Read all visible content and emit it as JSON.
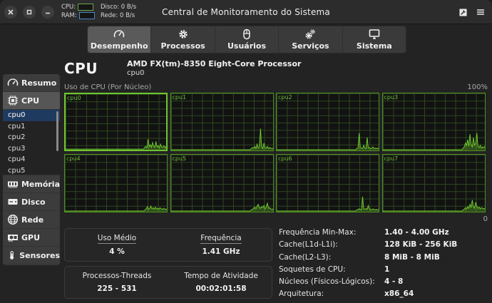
{
  "window": {
    "title": "Central de Monitoramento do Sistema",
    "mini": {
      "cpu_label": "CPU:",
      "ram_label": "RAM:",
      "disk_label": "Disco:",
      "disk_value": "0 B/s",
      "net_label": "Rede:",
      "net_value": "0 B/s"
    }
  },
  "tabs": [
    {
      "label": "Desempenho",
      "icon": "speedometer-icon",
      "active": true
    },
    {
      "label": "Processos",
      "icon": "gear-icon"
    },
    {
      "label": "Usuários",
      "icon": "mouse-icon"
    },
    {
      "label": "Serviços",
      "icon": "gears-icon"
    },
    {
      "label": "Sistema",
      "icon": "monitor-icon"
    }
  ],
  "sidebar": {
    "resumo": "Resumo",
    "cpu": "CPU",
    "cores": [
      "cpu0",
      "cpu1",
      "cpu2",
      "cpu3",
      "cpu4",
      "cpu5"
    ],
    "memoria": "Memória",
    "disco": "Disco",
    "rede": "Rede",
    "gpu": "GPU",
    "sensores": "Sensores"
  },
  "header": {
    "title": "CPU",
    "model": "AMD FX(tm)-8350 Eight-Core Processor",
    "selected": "cpu0"
  },
  "graph": {
    "label": "Uso de CPU (Por Núcleo)",
    "max": "100%",
    "min": "0",
    "line_color": "#6ec52f",
    "cores": [
      {
        "name": "cpu0",
        "values": [
          0,
          0,
          0,
          0,
          0,
          0,
          0,
          0,
          0,
          0,
          0,
          0,
          0,
          0,
          0,
          0,
          0,
          0,
          0,
          0,
          0,
          0,
          0,
          0,
          0,
          0,
          0,
          0,
          0,
          0,
          0,
          0,
          0,
          0,
          0,
          0,
          0,
          0,
          0,
          0,
          0,
          0,
          0,
          0,
          0,
          0,
          0,
          0,
          0,
          0,
          0,
          0,
          0,
          0,
          0,
          0,
          0,
          0,
          0,
          0,
          0,
          0,
          0,
          0,
          0,
          0,
          0,
          0,
          0,
          0,
          3,
          5,
          2,
          18,
          4,
          8,
          3,
          12,
          5,
          3,
          14,
          4,
          6,
          2,
          9,
          4,
          3,
          6,
          2,
          5
        ]
      },
      {
        "name": "cpu1",
        "values": [
          0,
          0,
          0,
          0,
          0,
          0,
          0,
          0,
          0,
          0,
          0,
          0,
          0,
          0,
          0,
          0,
          0,
          0,
          0,
          0,
          0,
          0,
          0,
          0,
          0,
          0,
          0,
          0,
          0,
          0,
          0,
          0,
          0,
          0,
          0,
          0,
          0,
          0,
          0,
          0,
          0,
          0,
          0,
          0,
          0,
          0,
          0,
          0,
          0,
          0,
          0,
          0,
          0,
          0,
          0,
          0,
          0,
          0,
          0,
          0,
          0,
          0,
          0,
          0,
          0,
          0,
          0,
          0,
          0,
          0,
          2,
          4,
          3,
          6,
          2,
          10,
          3,
          5,
          38,
          6,
          2,
          12,
          4,
          3,
          6,
          2,
          4,
          3,
          2,
          3
        ]
      },
      {
        "name": "cpu2",
        "values": [
          0,
          0,
          0,
          0,
          0,
          0,
          0,
          0,
          0,
          0,
          0,
          0,
          0,
          0,
          0,
          0,
          0,
          0,
          0,
          0,
          0,
          0,
          0,
          0,
          0,
          0,
          0,
          0,
          0,
          0,
          0,
          0,
          0,
          0,
          0,
          0,
          0,
          0,
          0,
          0,
          0,
          0,
          0,
          0,
          0,
          0,
          0,
          0,
          0,
          0,
          0,
          0,
          0,
          0,
          0,
          0,
          0,
          0,
          0,
          0,
          0,
          0,
          0,
          0,
          0,
          0,
          0,
          0,
          0,
          0,
          2,
          3,
          30,
          4,
          3,
          2,
          8,
          3,
          2,
          22,
          3,
          4,
          2,
          3,
          5,
          2,
          3,
          2,
          3,
          2
        ]
      },
      {
        "name": "cpu3",
        "values": [
          0,
          0,
          0,
          0,
          0,
          0,
          0,
          0,
          0,
          0,
          0,
          0,
          0,
          0,
          0,
          0,
          0,
          0,
          0,
          0,
          0,
          0,
          0,
          0,
          0,
          0,
          0,
          0,
          0,
          0,
          0,
          0,
          0,
          0,
          0,
          0,
          0,
          0,
          0,
          0,
          0,
          0,
          0,
          0,
          0,
          0,
          0,
          0,
          0,
          0,
          0,
          0,
          0,
          0,
          0,
          0,
          0,
          0,
          0,
          0,
          0,
          0,
          0,
          0,
          0,
          0,
          0,
          0,
          0,
          0,
          3,
          5,
          12,
          8,
          18,
          6,
          28,
          10,
          5,
          22,
          8,
          12,
          30,
          6,
          4,
          8,
          3,
          5,
          4,
          6
        ]
      },
      {
        "name": "cpu4",
        "values": [
          0,
          0,
          0,
          0,
          0,
          0,
          0,
          0,
          0,
          0,
          0,
          0,
          0,
          0,
          0,
          0,
          0,
          0,
          0,
          0,
          0,
          0,
          0,
          0,
          0,
          0,
          0,
          0,
          0,
          0,
          0,
          0,
          0,
          0,
          0,
          0,
          0,
          0,
          0,
          0,
          0,
          0,
          0,
          0,
          0,
          0,
          0,
          0,
          0,
          0,
          0,
          0,
          0,
          0,
          0,
          0,
          0,
          0,
          0,
          0,
          0,
          0,
          0,
          0,
          0,
          0,
          0,
          0,
          0,
          0,
          2,
          4,
          8,
          3,
          5,
          9,
          4,
          6,
          3,
          7,
          4,
          5,
          3,
          6,
          4,
          3,
          5,
          3,
          4,
          3
        ]
      },
      {
        "name": "cpu5",
        "values": [
          0,
          0,
          0,
          0,
          0,
          0,
          0,
          0,
          0,
          0,
          0,
          0,
          0,
          0,
          0,
          0,
          0,
          0,
          0,
          0,
          0,
          0,
          0,
          0,
          0,
          0,
          0,
          0,
          0,
          0,
          0,
          0,
          0,
          0,
          0,
          0,
          0,
          0,
          0,
          0,
          0,
          0,
          0,
          0,
          0,
          0,
          0,
          0,
          0,
          0,
          0,
          0,
          0,
          0,
          0,
          0,
          0,
          0,
          0,
          0,
          0,
          0,
          0,
          0,
          0,
          0,
          0,
          0,
          0,
          0,
          2,
          3,
          5,
          7,
          4,
          9,
          12,
          6,
          5,
          8,
          6,
          10,
          4,
          7,
          14,
          5,
          6,
          4,
          3,
          4
        ]
      },
      {
        "name": "cpu6",
        "values": [
          0,
          0,
          0,
          0,
          0,
          0,
          0,
          0,
          0,
          0,
          0,
          0,
          0,
          0,
          0,
          0,
          0,
          0,
          0,
          0,
          0,
          0,
          0,
          0,
          0,
          0,
          0,
          0,
          0,
          0,
          0,
          0,
          0,
          0,
          0,
          0,
          0,
          0,
          0,
          0,
          0,
          0,
          0,
          0,
          0,
          0,
          0,
          0,
          0,
          0,
          0,
          0,
          0,
          0,
          0,
          0,
          0,
          0,
          0,
          0,
          0,
          0,
          0,
          0,
          0,
          0,
          0,
          0,
          0,
          0,
          2,
          3,
          4,
          3,
          2,
          26,
          4,
          3,
          5,
          3,
          10,
          4,
          3,
          2,
          4,
          3,
          2,
          3,
          2,
          3
        ]
      },
      {
        "name": "cpu7",
        "values": [
          0,
          0,
          0,
          0,
          0,
          0,
          0,
          0,
          0,
          0,
          0,
          0,
          0,
          0,
          0,
          0,
          0,
          0,
          0,
          0,
          0,
          0,
          0,
          0,
          0,
          0,
          0,
          0,
          0,
          0,
          0,
          0,
          0,
          0,
          0,
          0,
          0,
          0,
          0,
          0,
          0,
          0,
          0,
          0,
          0,
          0,
          0,
          0,
          0,
          0,
          0,
          0,
          0,
          0,
          0,
          0,
          0,
          0,
          0,
          0,
          0,
          0,
          0,
          0,
          0,
          0,
          0,
          0,
          0,
          0,
          2,
          3,
          6,
          4,
          8,
          5,
          12,
          6,
          20,
          8,
          5,
          16,
          9,
          5,
          7,
          4,
          6,
          5,
          4,
          5
        ]
      }
    ]
  },
  "stats": {
    "uso_medio_label": "Uso Médio",
    "uso_medio_value": "4 %",
    "frequencia_label": "Frequência",
    "frequencia_value": "1.41 GHz",
    "processos_label": "Processos-Threads",
    "processos_value": "225 - 531",
    "tempo_label": "Tempo de Atividade",
    "tempo_value": "00:02:01:58"
  },
  "info": [
    {
      "k": "Frequência Min-Max:",
      "v": "1.40 - 4.00 GHz"
    },
    {
      "k": "Cache(L1d-L1i):",
      "v": "128 KiB - 256 KiB"
    },
    {
      "k": "Cache(L2-L3):",
      "v": "8 MiB - 8 MiB"
    },
    {
      "k": "Soquetes de CPU:",
      "v": "1"
    },
    {
      "k": "Núcleos (Físicos-Lógicos):",
      "v": "4 - 8"
    },
    {
      "k": "Arquitetura:",
      "v": "x86_64"
    }
  ]
}
